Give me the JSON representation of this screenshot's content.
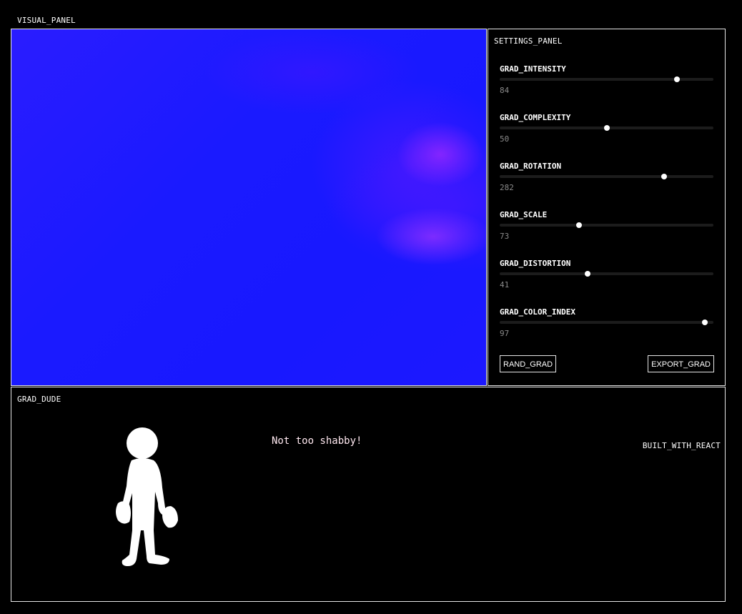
{
  "visual_panel": {
    "label": "VISUAL_PANEL",
    "colors": {
      "base": "#1818ff",
      "highlight": "#9632ff"
    }
  },
  "settings_panel": {
    "title": "SETTINGS_PANEL",
    "sliders": [
      {
        "name": "GRAD_INTENSITY",
        "value": "84"
      },
      {
        "name": "GRAD_COMPLEXITY",
        "value": "50"
      },
      {
        "name": "GRAD_ROTATION",
        "value": "282"
      },
      {
        "name": "GRAD_SCALE",
        "value": "73"
      },
      {
        "name": "GRAD_DISTORTION",
        "value": "41"
      },
      {
        "name": "GRAD_COLOR_INDEX",
        "value": "97"
      }
    ],
    "slider_levels": [
      0.83,
      0.5,
      0.77,
      0.37,
      0.41,
      0.96
    ],
    "buttons": {
      "random": "RAND_GRAD",
      "export": "EXPORT_GRAD"
    }
  },
  "dude_panel": {
    "title": "GRAD_DUDE",
    "speech": "Not too shabby!",
    "footer": "BUILT_WITH_REACT",
    "figure_icon": "person-silhouette-icon"
  }
}
